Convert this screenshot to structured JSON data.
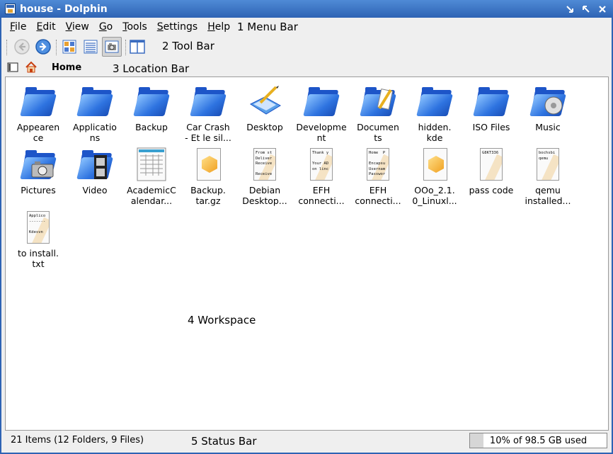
{
  "window": {
    "title": "house - Dolphin"
  },
  "menubar": {
    "items": [
      {
        "label": "File"
      },
      {
        "label": "Edit"
      },
      {
        "label": "View"
      },
      {
        "label": "Go"
      },
      {
        "label": "Tools"
      },
      {
        "label": "Settings"
      },
      {
        "label": "Help"
      }
    ]
  },
  "toolbar": {
    "buttons": [
      {
        "icon": "back-arrow-icon",
        "enabled": false
      },
      {
        "icon": "forward-arrow-icon",
        "enabled": true
      },
      {
        "icon": "icons-view-icon"
      },
      {
        "icon": "details-view-icon"
      },
      {
        "icon": "preview-view-icon",
        "active": true
      },
      {
        "icon": "split-view-icon"
      }
    ]
  },
  "location": {
    "label": "Home"
  },
  "annotations": {
    "menu_bar": "1 Menu  Bar",
    "tool_bar": "2 Tool Bar",
    "location_bar": "3 Location Bar",
    "workspace": "4 Workspace",
    "status_bar": "5 Status Bar"
  },
  "files": [
    {
      "name": "Appearence",
      "label": "Appearen\nce",
      "kind": "folder"
    },
    {
      "name": "Applications",
      "label": "Applicatio\nns",
      "kind": "folder"
    },
    {
      "name": "Backup",
      "label": "Backup",
      "kind": "folder"
    },
    {
      "name": "Car Crash - Et le sil...",
      "label": "Car Crash\n- Et le sil...",
      "kind": "folder"
    },
    {
      "name": "Desktop",
      "label": "Desktop",
      "kind": "desktop"
    },
    {
      "name": "Development",
      "label": "Developme\nnt",
      "kind": "folder"
    },
    {
      "name": "Documents",
      "label": "Documen\nts",
      "kind": "folder-docs"
    },
    {
      "name": "hidden.kde",
      "label": "hidden.\nkde",
      "kind": "folder"
    },
    {
      "name": "ISO Files",
      "label": "ISO Files",
      "kind": "folder"
    },
    {
      "name": "Music",
      "label": "Music",
      "kind": "folder-music"
    },
    {
      "name": "Pictures",
      "label": "Pictures",
      "kind": "folder-pictures"
    },
    {
      "name": "Video",
      "label": "Video",
      "kind": "folder-video"
    },
    {
      "name": "AcademicCalendar...",
      "label": "AcademicC\nalendar...",
      "kind": "spreadsheet"
    },
    {
      "name": "Backup.tar.gz",
      "label": "Backup.\ntar.gz",
      "kind": "package"
    },
    {
      "name": "Debian Desktop...",
      "label": "Debian\nDesktop...",
      "kind": "text",
      "preview": "From st\nDeliver\nReceive\n\nReceive"
    },
    {
      "name": "EFH connecti...",
      "label": "EFH\nconnecti...",
      "kind": "text",
      "preview": "Thank y\n\nYour AD\non linc"
    },
    {
      "name": "EFH connecti...",
      "label": "EFH\nconnecti...",
      "kind": "text",
      "preview": "Home  P\n\nEncapsu\nUsernam\nPasswor"
    },
    {
      "name": "OOo_2.1.0_Linuxl...",
      "label": "OOo_2.1.\n0_Linuxl...",
      "kind": "package"
    },
    {
      "name": "pass code",
      "label": "pass code",
      "kind": "text",
      "preview": "G8KT336"
    },
    {
      "name": "qemu installed...",
      "label": "qemu\ninstalled...",
      "kind": "text",
      "preview": "bochsbi\nqemu"
    },
    {
      "name": "to install.txt",
      "label": "to install.\ntxt",
      "kind": "text",
      "preview": "Applico\n-------\n\nKdesvn"
    }
  ],
  "status": {
    "text": "21 Items (12 Folders, 9 Files)",
    "capacity_text": "10% of 98.5 GB used",
    "capacity_fraction": 0.1
  },
  "colors": {
    "titlebar": "#2e63b4",
    "folder": "#2e73e0",
    "window_bg": "#efefef"
  }
}
